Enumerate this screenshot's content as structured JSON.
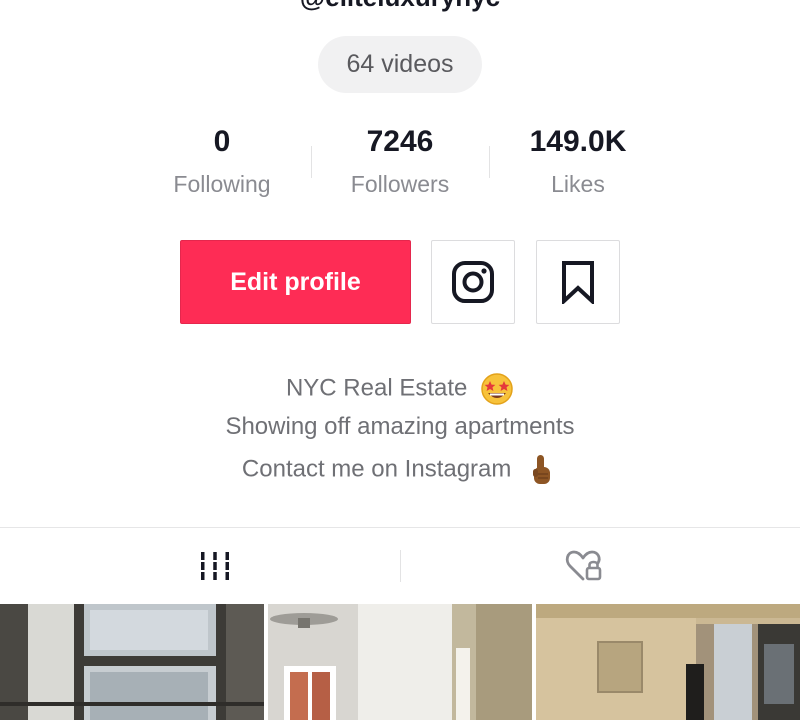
{
  "profile": {
    "handle": "@eliteluxurynyc",
    "video_count": "64 videos"
  },
  "stats": [
    {
      "value": "0",
      "label": "Following"
    },
    {
      "value": "7246",
      "label": "Followers"
    },
    {
      "value": "149.0K",
      "label": "Likes"
    }
  ],
  "actions": {
    "edit_profile": "Edit profile",
    "instagram_icon": "instagram-icon",
    "bookmark_icon": "bookmark-icon"
  },
  "bio": {
    "line1": "NYC Real Estate",
    "line1_emoji": "star-struck-emoji",
    "line2": "Showing off amazing apartments",
    "line3": "Contact me on Instagram",
    "line3_emoji": "pointing-up-emoji"
  },
  "tabs": [
    {
      "icon": "videos-grid-icon",
      "active": true
    },
    {
      "icon": "liked-locked-icon",
      "active": false
    }
  ],
  "colors": {
    "accent": "#fe2c55",
    "text_primary": "#161823",
    "text_secondary": "#8a8b91"
  }
}
